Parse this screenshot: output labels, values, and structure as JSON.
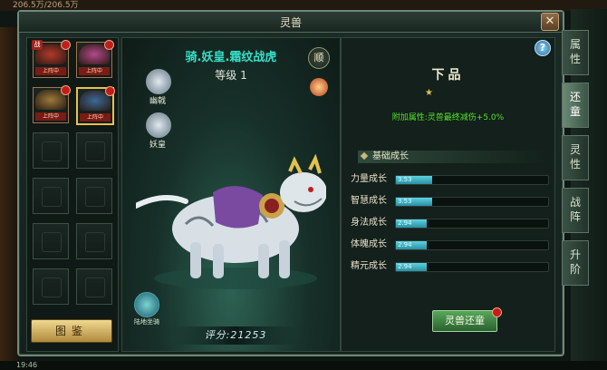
{
  "topbar": {
    "text": "206.5万/206.5万"
  },
  "window": {
    "title": "灵兽",
    "close_label": "✕"
  },
  "pet_list": {
    "slots": [
      {
        "filled": true,
        "status": "上阵中",
        "war": "战",
        "color": "#b23a2a"
      },
      {
        "filled": true,
        "status": "上阵中",
        "war": "",
        "color": "#b24a8a"
      },
      {
        "filled": true,
        "status": "上阵中",
        "war": "",
        "color": "#9a7a3a"
      },
      {
        "filled": true,
        "status": "上阵中",
        "war": "",
        "color": "#3a6a9a",
        "selected": true
      },
      {
        "filled": false
      },
      {
        "filled": false
      },
      {
        "filled": false
      },
      {
        "filled": false
      },
      {
        "filled": false
      },
      {
        "filled": false
      },
      {
        "filled": false
      },
      {
        "filled": false
      }
    ],
    "tujian_label": "图鉴"
  },
  "pet": {
    "name": "骑.妖皇.霜纹战虎",
    "level": "等级 1",
    "skills": [
      {
        "label": "幽戟"
      },
      {
        "label": "妖皇"
      }
    ],
    "shun_label": "顺",
    "ground_label": "陆地坐骑",
    "score": "评分:21253"
  },
  "info": {
    "help": "?",
    "grade": "下品",
    "bonus": "附加属性:灵兽最终减伤+5.0%",
    "section_title": "基础成长",
    "stats": [
      {
        "label": "力量成长",
        "value": "3.53",
        "fill": 0.24
      },
      {
        "label": "智慧成长",
        "value": "3.53",
        "fill": 0.24
      },
      {
        "label": "身法成长",
        "value": "2.94",
        "fill": 0.2
      },
      {
        "label": "体魄成长",
        "value": "2.94",
        "fill": 0.2
      },
      {
        "label": "精元成长",
        "value": "2.94",
        "fill": 0.2
      }
    ],
    "restore_button": "灵兽还童"
  },
  "tabs": [
    {
      "label": "属性"
    },
    {
      "label": "还童",
      "active": true
    },
    {
      "label": "灵性"
    },
    {
      "label": "战阵"
    },
    {
      "label": "升阶"
    }
  ],
  "bottombar": {
    "time": "19:46"
  }
}
